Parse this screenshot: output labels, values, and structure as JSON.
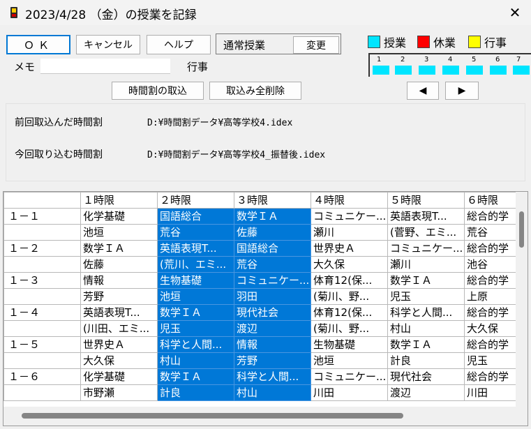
{
  "window": {
    "title": "2023/4/28 （金）の授業を記録",
    "close_glyph": "✕"
  },
  "toolbar": {
    "ok_label": "ＯＫ",
    "cancel_label": "キャンセル",
    "help_label": "ヘルプ",
    "mode_label": "通常授業",
    "change_label": "変更",
    "import_label": "時間割の取込",
    "delete_all_label": "取込み全削除",
    "prev_glyph": "◀",
    "next_glyph": "▶"
  },
  "memo": {
    "label": "メモ",
    "value": ""
  },
  "event_label": "行事",
  "legend": [
    {
      "label": "授業",
      "color": "#00e5ff"
    },
    {
      "label": "休業",
      "color": "#ff0000"
    },
    {
      "label": "行事",
      "color": "#ffff00"
    }
  ],
  "period_strip": {
    "numbers": [
      "1",
      "2",
      "3",
      "4",
      "5",
      "6",
      "7"
    ],
    "bar_color": "#00e5ff"
  },
  "info": {
    "previous_label": "前回取込んだ時間割",
    "previous_path": "D:¥時間割データ¥高等学校4.idex",
    "current_label": "今回取り込む時間割",
    "current_path": "D:¥時間割データ¥高等学校4_振替後.idex"
  },
  "timetable": {
    "headers": [
      "",
      "１時限",
      "２時限",
      "３時限",
      "４時限",
      "５時限",
      "６時限"
    ],
    "rows": [
      [
        "１－１",
        "化学基礎",
        "国語総合",
        "数学ＩＡ",
        "コミュニケー...",
        "英語表現T...",
        "総合的学"
      ],
      [
        "",
        "池垣",
        "荒谷",
        "佐藤",
        "瀬川",
        "(菅野、エミ...",
        "荒谷"
      ],
      [
        "１－２",
        "数学ＩＡ",
        "英語表現T...",
        "国語総合",
        "世界史Ａ",
        "コミュニケー...",
        "総合的学"
      ],
      [
        "",
        "佐藤",
        "(荒川、エミ...",
        "荒谷",
        "大久保",
        "瀬川",
        "池谷"
      ],
      [
        "１－３",
        "情報",
        "生物基礎",
        "コミュニケー...",
        "体育12(保...",
        "数学ＩＡ",
        "総合的学"
      ],
      [
        "",
        "芳野",
        "池垣",
        "羽田",
        "(菊川、野...",
        "児玉",
        "上原"
      ],
      [
        "１－４",
        "英語表現T...",
        "数学ＩＡ",
        "現代社会",
        "体育12(保...",
        "科学と人間...",
        "総合的学"
      ],
      [
        "",
        "(川田、エミ...",
        "児玉",
        "渡辺",
        "(菊川、野...",
        "村山",
        "大久保"
      ],
      [
        "１－５",
        "世界史Ａ",
        "科学と人間...",
        "情報",
        "生物基礎",
        "数学ＩＡ",
        "総合的学"
      ],
      [
        "",
        "大久保",
        "村山",
        "芳野",
        "池垣",
        "計良",
        "児玉"
      ],
      [
        "１－６",
        "化学基礎",
        "数学ＩＡ",
        "科学と人間...",
        "コミュニケー...",
        "現代社会",
        "総合的学"
      ],
      [
        "",
        "市野瀬",
        "計良",
        "村山",
        "川田",
        "渡辺",
        "川田"
      ]
    ],
    "selected_columns": [
      2,
      3
    ],
    "selection_color": "#0078d7"
  }
}
